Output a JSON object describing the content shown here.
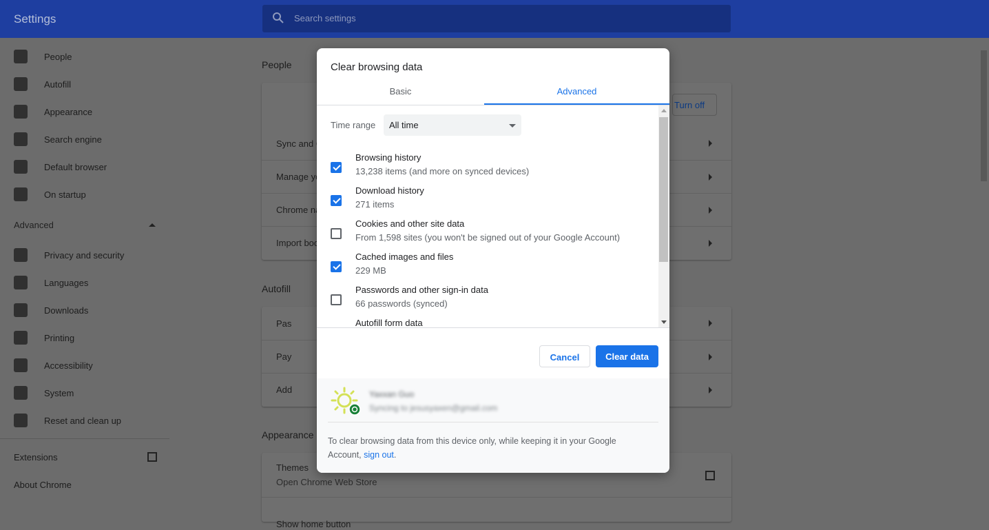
{
  "header": {
    "title": "Settings",
    "search_placeholder": "Search settings"
  },
  "sidebar": {
    "items": [
      {
        "label": "People",
        "icon": "person-icon"
      },
      {
        "label": "Autofill",
        "icon": "clipboard-icon"
      },
      {
        "label": "Appearance",
        "icon": "palette-icon"
      },
      {
        "label": "Search engine",
        "icon": "search-icon"
      },
      {
        "label": "Default browser",
        "icon": "browser-icon"
      },
      {
        "label": "On startup",
        "icon": "power-icon"
      }
    ],
    "advanced_label": "Advanced",
    "advanced_items": [
      {
        "label": "Privacy and security",
        "icon": "shield-icon"
      },
      {
        "label": "Languages",
        "icon": "globe-icon"
      },
      {
        "label": "Downloads",
        "icon": "download-icon"
      },
      {
        "label": "Printing",
        "icon": "printer-icon"
      },
      {
        "label": "Accessibility",
        "icon": "accessibility-icon"
      },
      {
        "label": "System",
        "icon": "wrench-icon"
      },
      {
        "label": "Reset and clean up",
        "icon": "reset-icon"
      }
    ],
    "extensions": "Extensions",
    "about": "About Chrome"
  },
  "main": {
    "people_title": "People",
    "turn_off": "Turn off",
    "people_rows": [
      "Sync and G",
      "Manage yo",
      "Chrome na",
      "Import boo"
    ],
    "autofill_title": "Autofill",
    "autofill_rows": [
      "Pas",
      "Pay",
      "Add"
    ],
    "appearance_title": "Appearance",
    "themes": "Themes",
    "themes_sub": "Open Chrome Web Store",
    "show_home": "Show home button"
  },
  "dialog": {
    "title": "Clear browsing data",
    "tabs": [
      "Basic",
      "Advanced"
    ],
    "active_tab": "Advanced",
    "time_range_label": "Time range",
    "time_range_value": "All time",
    "items": [
      {
        "label": "Browsing history",
        "sub": "13,238 items (and more on synced devices)",
        "checked": true
      },
      {
        "label": "Download history",
        "sub": "271 items",
        "checked": true
      },
      {
        "label": "Cookies and other site data",
        "sub": "From 1,598 sites (you won't be signed out of your Google Account)",
        "checked": false
      },
      {
        "label": "Cached images and files",
        "sub": "229 MB",
        "checked": true
      },
      {
        "label": "Passwords and other sign-in data",
        "sub": "66 passwords (synced)",
        "checked": false
      },
      {
        "label": "Autofill form data",
        "sub": "",
        "checked": false
      }
    ],
    "cancel": "Cancel",
    "clear": "Clear data",
    "account_name": "Yaxxan Guo",
    "account_sync": "Syncing to jesusyaxen@gmail.com",
    "footer_text": "To clear browsing data from this device only, while keeping it in your Google Account, ",
    "sign_out": "sign out",
    "footer_end": ".",
    "accent": "#1a73e8"
  }
}
